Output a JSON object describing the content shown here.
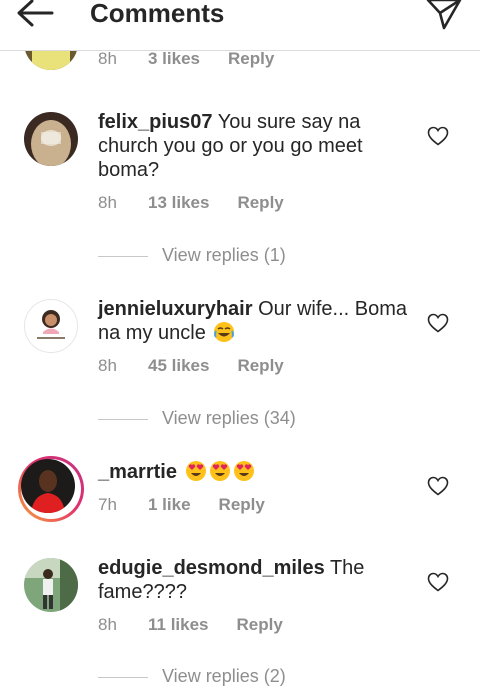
{
  "header": {
    "title": "Comments",
    "back_icon": "arrow-left-icon",
    "share_icon": "paper-plane-icon"
  },
  "comments": [
    {
      "time": "8h",
      "likes": "3 likes",
      "reply": "Reply"
    },
    {
      "username": "felix_pius07",
      "text": "You sure say na church you go or you go meet boma?",
      "time": "8h",
      "likes": "13 likes",
      "reply": "Reply",
      "view_replies": "View replies (1)"
    },
    {
      "username": "jennieluxuryhair",
      "text": "Our wife... Boma na my uncle",
      "emoji": "joy-emoji",
      "time": "8h",
      "likes": "45 likes",
      "reply": "Reply",
      "view_replies": "View replies (34)"
    },
    {
      "username": "_marrtie",
      "text": "",
      "emoji": "heart-eyes-emoji",
      "emoji_count": 3,
      "time": "7h",
      "likes": "1 like",
      "reply": "Reply"
    },
    {
      "username": "edugie_desmond_miles",
      "text": "The fame????",
      "time": "8h",
      "likes": "11 likes",
      "reply": "Reply",
      "view_replies": "View replies (2)"
    }
  ],
  "colors": {
    "text": "#262626",
    "secondary": "#8e8e8e",
    "divider": "#dbdbdb",
    "story_ring_start": "#f9a33a",
    "story_ring_end": "#c13584"
  }
}
